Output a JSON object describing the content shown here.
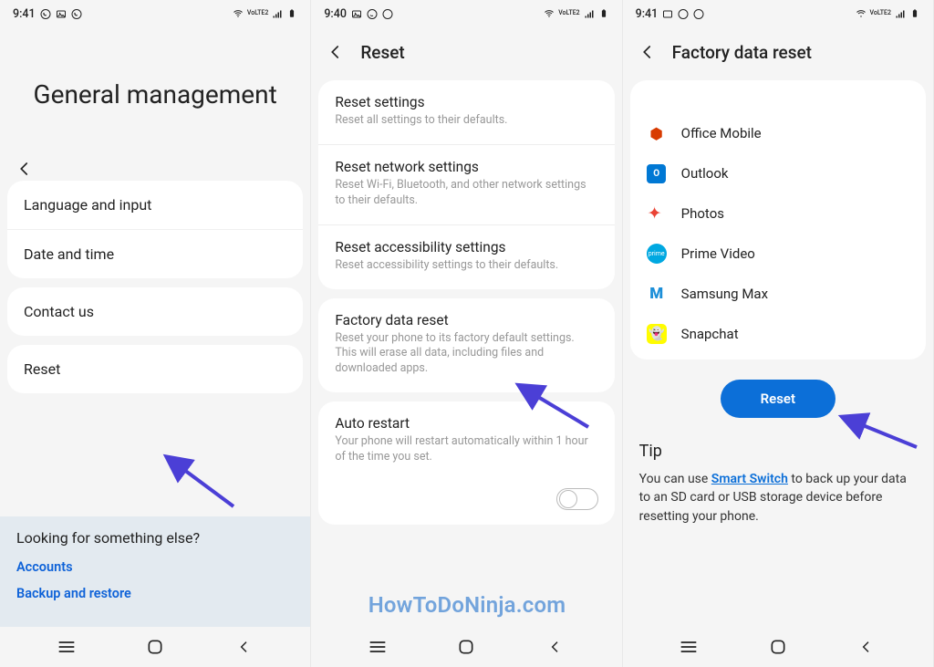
{
  "watermark": "HowToDoNinja.com",
  "screen1": {
    "time": "9:41",
    "title": "General management",
    "items": {
      "lang": "Language and input",
      "date": "Date and time",
      "contact": "Contact us",
      "reset": "Reset"
    },
    "bottom": {
      "title": "Looking for something else?",
      "link1": "Accounts",
      "link2": "Backup and restore"
    }
  },
  "screen2": {
    "time": "9:40",
    "title": "Reset",
    "items": [
      {
        "title": "Reset settings",
        "desc": "Reset all settings to their defaults."
      },
      {
        "title": "Reset network settings",
        "desc": "Reset Wi-Fi, Bluetooth, and other network settings to their defaults."
      },
      {
        "title": "Reset accessibility settings",
        "desc": "Reset accessibility settings to their defaults."
      },
      {
        "title": "Factory data reset",
        "desc": "Reset your phone to its factory default settings. This will erase all data, including files and downloaded apps."
      },
      {
        "title": "Auto restart",
        "desc": "Your phone will restart automatically within 1 hour of the time you set."
      }
    ]
  },
  "screen3": {
    "time": "9:41",
    "title": "Factory data reset",
    "apps": [
      "Office Mobile",
      "Outlook",
      "Photos",
      "Prime Video",
      "Samsung Max",
      "Snapchat"
    ],
    "reset_btn": "Reset",
    "tip_title": "Tip",
    "tip_before": "You can use ",
    "tip_link": "Smart Switch",
    "tip_after": " to back up your data to an SD card or USB storage device before resetting your phone."
  },
  "status_vo": "VoLTE2"
}
